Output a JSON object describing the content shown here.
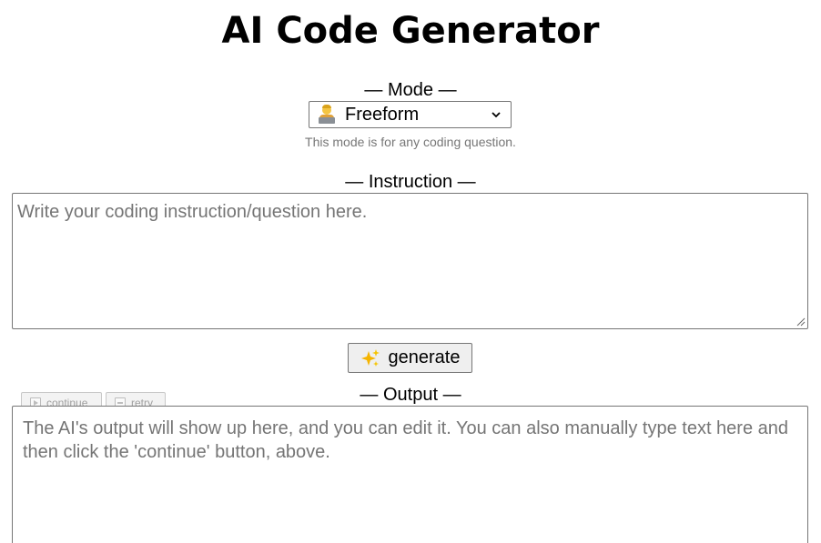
{
  "header": {
    "title": "AI Code Generator"
  },
  "mode": {
    "label": "— Mode —",
    "selected": "Freeform",
    "selected_icon": "technologist-emoji",
    "help_text": "This mode is for any coding question."
  },
  "instruction": {
    "label": "— Instruction —",
    "placeholder": "Write your coding instruction/question here.",
    "value": ""
  },
  "actions": {
    "generate_label": "generate",
    "generate_icon": "sparkles-icon"
  },
  "output": {
    "label": "— Output —",
    "placeholder": "The AI's output will show up here, and you can edit it. You can also manually type text here and then click the 'continue' button, above.",
    "value": "",
    "continue_label": "continue",
    "retry_label": "retry",
    "continue_icon": "play-icon",
    "retry_icon": "retry-icon"
  },
  "colors": {
    "border": "#767676",
    "placeholder_text": "#757575",
    "help_text": "#777777",
    "disabled_text": "#a0a0a0",
    "button_bg": "#efefef"
  }
}
